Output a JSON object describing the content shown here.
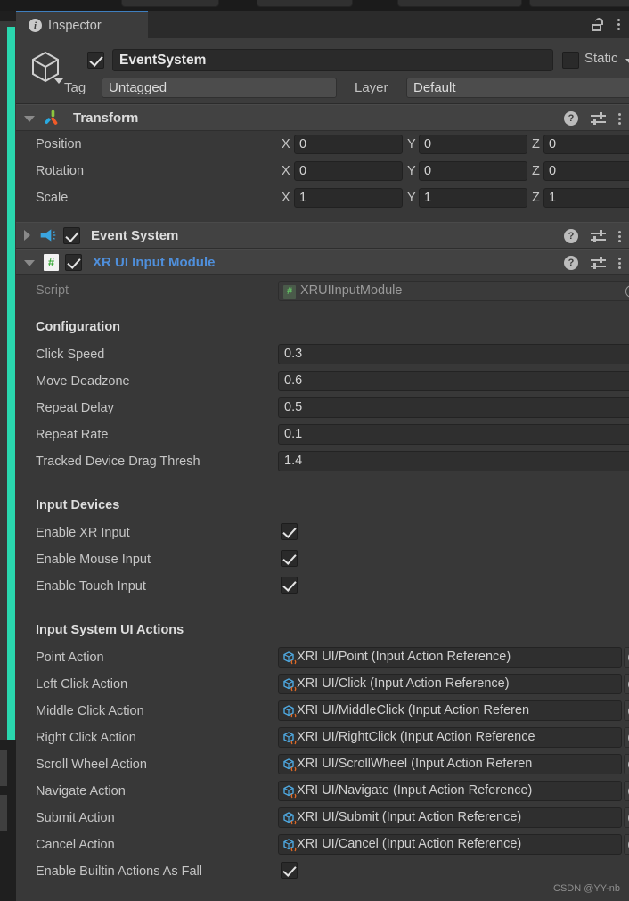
{
  "window": {
    "tab_label": "Inspector",
    "info_icon": "info-icon",
    "lock_icon": "lock-unlocked-icon",
    "menu_icon": "kebab-menu-icon"
  },
  "gameobject": {
    "enabled": true,
    "name": "EventSystem",
    "static_label": "Static",
    "static_checked": false,
    "tag_label": "Tag",
    "tag_value": "Untagged",
    "layer_label": "Layer",
    "layer_value": "Default",
    "icon": "cube-gameobject-icon"
  },
  "components": [
    {
      "title": "Transform",
      "expanded": true,
      "icon": "transform-axis-icon",
      "rows": [
        {
          "label": "Position",
          "x": "0",
          "y": "0",
          "z": "0"
        },
        {
          "label": "Rotation",
          "x": "0",
          "y": "0",
          "z": "0"
        },
        {
          "label": "Scale",
          "x": "1",
          "y": "1",
          "z": "1"
        }
      ],
      "axes": [
        "X",
        "Y",
        "Z"
      ]
    },
    {
      "title": "Event System",
      "expanded": false,
      "enabled": true,
      "icon": "megaphone-icon"
    },
    {
      "title": "XR UI Input Module",
      "expanded": true,
      "enabled": true,
      "icon": "script-hash-icon"
    }
  ],
  "xr_ui_input_module": {
    "script_label": "Script",
    "script_value": "XRUIInputModule",
    "sections": {
      "configuration": {
        "title": "Configuration",
        "fields": [
          {
            "label": "Click Speed",
            "value": "0.3"
          },
          {
            "label": "Move Deadzone",
            "value": "0.6"
          },
          {
            "label": "Repeat Delay",
            "value": "0.5"
          },
          {
            "label": "Repeat Rate",
            "value": "0.1"
          },
          {
            "label": "Tracked Device Drag Thresh",
            "value": "1.4"
          }
        ]
      },
      "input_devices": {
        "title": "Input Devices",
        "fields": [
          {
            "label": "Enable XR Input",
            "checked": true
          },
          {
            "label": "Enable Mouse Input",
            "checked": true
          },
          {
            "label": "Enable Touch Input",
            "checked": true
          }
        ]
      },
      "input_system_ui_actions": {
        "title": "Input System UI Actions",
        "fields": [
          {
            "label": "Point Action",
            "value": "XRI UI/Point (Input Action Reference)"
          },
          {
            "label": "Left Click Action",
            "value": "XRI UI/Click (Input Action Reference)"
          },
          {
            "label": "Middle Click Action",
            "value": "XRI UI/MiddleClick (Input Action Referen"
          },
          {
            "label": "Right Click Action",
            "value": "XRI UI/RightClick (Input Action Reference"
          },
          {
            "label": "Scroll Wheel Action",
            "value": "XRI UI/ScrollWheel (Input Action Referen"
          },
          {
            "label": "Navigate Action",
            "value": "XRI UI/Navigate (Input Action Reference)"
          },
          {
            "label": "Submit Action",
            "value": "XRI UI/Submit (Input Action Reference)"
          },
          {
            "label": "Cancel Action",
            "value": "XRI UI/Cancel (Input Action Reference)"
          }
        ],
        "fallback": {
          "label": "Enable Builtin Actions As Fall",
          "checked": true
        }
      }
    }
  },
  "watermark": "CSDN @YY-nb",
  "colors": {
    "accent_tab": "#3f7fbf",
    "teal": "#2ad6ae",
    "link": "#4f8fdb",
    "panel": "#383838",
    "header": "#424242"
  }
}
